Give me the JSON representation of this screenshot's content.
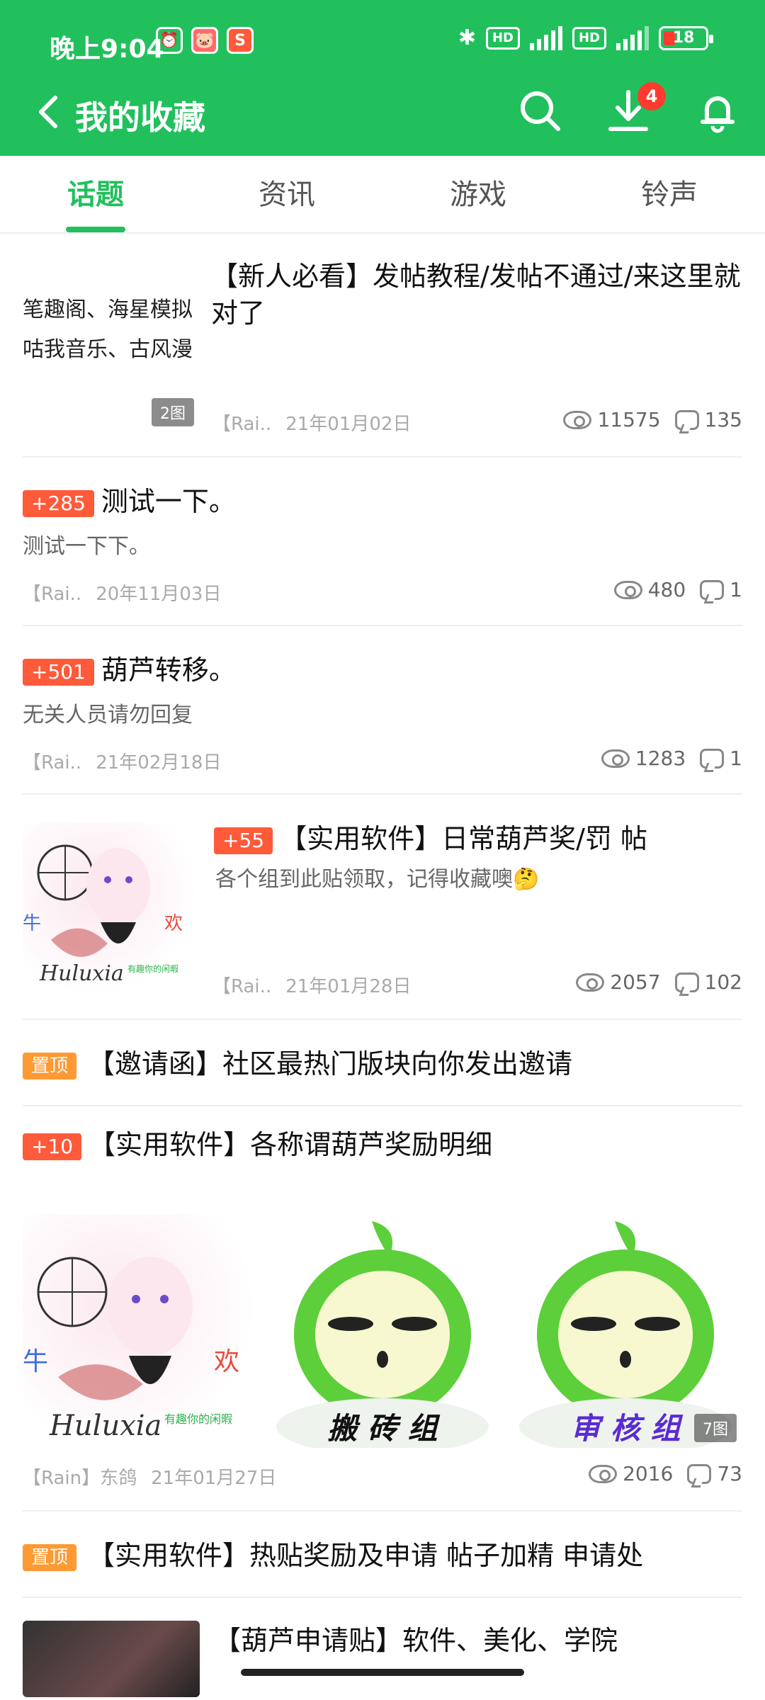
{
  "status_bar": {
    "time": "晚上9:04",
    "battery": "18"
  },
  "header": {
    "title": "我的收藏",
    "download_badge": "4"
  },
  "tabs": [
    {
      "label": "话题",
      "active": true
    },
    {
      "label": "资讯",
      "active": false
    },
    {
      "label": "游戏",
      "active": false
    },
    {
      "label": "铃声",
      "active": false
    }
  ],
  "posts": [
    {
      "title": "【新人必看】发帖教程/发帖不通过/来这里就对了",
      "thumb_lines": [
        "笔趣阁、海星模拟",
        "咕我音乐、古风漫"
      ],
      "thumb_tag": "2图",
      "author": "【Rai..",
      "date": "21年01月02日",
      "views": "11575",
      "comments": "135"
    },
    {
      "score": "+285",
      "title": "测试一下。",
      "summary": "测试一下下。",
      "author": "【Rai..",
      "date": "20年11月03日",
      "views": "480",
      "comments": "1"
    },
    {
      "score": "+501",
      "title": "葫芦转移。",
      "summary": "无关人员请勿回复",
      "author": "【Rai..",
      "date": "21年02月18日",
      "views": "1283",
      "comments": "1"
    },
    {
      "score": "+55",
      "title": "【实用软件】日常葫芦奖/罚 帖",
      "summary": "各个组到此贴领取，记得收藏噢🤔",
      "author": "【Rai..",
      "date": "21年01月28日",
      "views": "2057",
      "comments": "102"
    },
    {
      "top_tag": "置顶",
      "title": "【邀请函】社区最热门版块向你发出邀请"
    },
    {
      "score": "+10",
      "title": "【实用软件】各称谓葫芦奖励明细",
      "image_captions": [
        "搬 砖 组",
        "审 核 组"
      ],
      "image_tag": "7图",
      "author": "【Rain】东鸽",
      "date": "21年01月27日",
      "views": "2016",
      "comments": "73"
    },
    {
      "top_tag": "置顶",
      "title": "【实用软件】热贴奖励及申请 帖子加精 申请处"
    },
    {
      "title": "【葫芦申请贴】软件、美化、学院"
    }
  ],
  "brand": "Huluxia",
  "brand_sub": "有趣你的闲暇"
}
